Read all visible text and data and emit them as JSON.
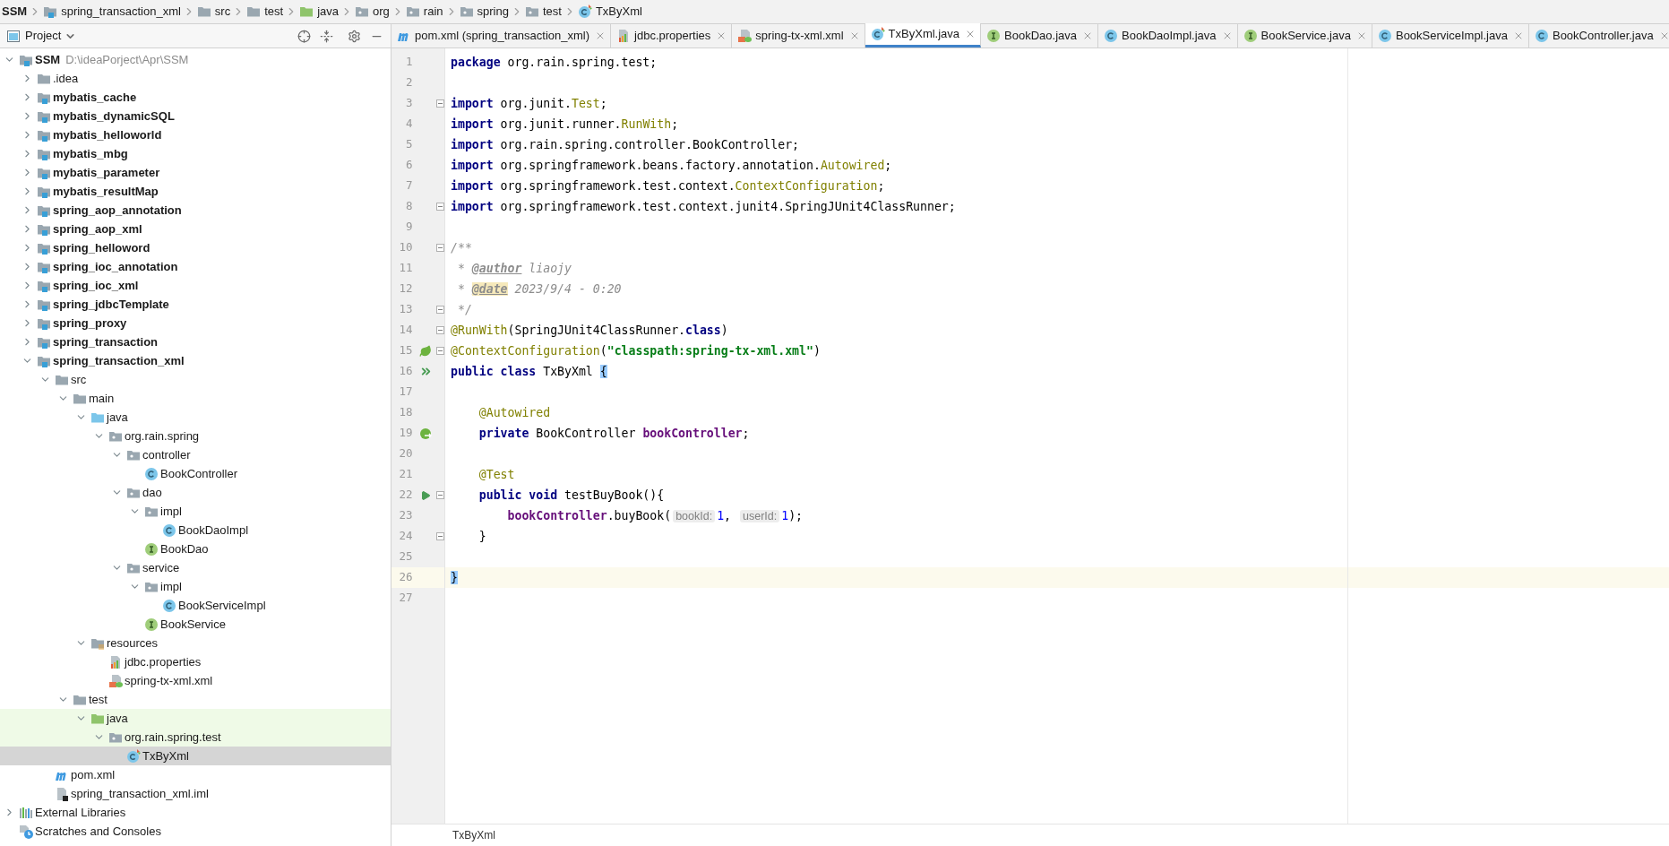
{
  "breadcrumb": [
    {
      "label": "SSM"
    },
    {
      "label": "spring_transaction_xml",
      "kind": "module"
    },
    {
      "label": "src",
      "kind": "folder"
    },
    {
      "label": "test",
      "kind": "folder"
    },
    {
      "label": "java",
      "kind": "test-root"
    },
    {
      "label": "org",
      "kind": "package"
    },
    {
      "label": "rain",
      "kind": "package"
    },
    {
      "label": "spring",
      "kind": "package"
    },
    {
      "label": "test",
      "kind": "package"
    },
    {
      "label": "TxByXml",
      "kind": "test-class"
    }
  ],
  "project_panel": {
    "title": "Project",
    "tree": [
      {
        "label": "SSM",
        "path": "D:\\ideaPorject\\Apr\\SSM",
        "kind": "module",
        "expanded": true,
        "selected": false,
        "highlighted": false,
        "children": [
          {
            "label": ".idea",
            "kind": "folder",
            "expanded": false,
            "selected": false,
            "highlighted": false
          },
          {
            "label": "mybatis_cache",
            "kind": "module",
            "expanded": false,
            "selected": false,
            "highlighted": false
          },
          {
            "label": "mybatis_dynamicSQL",
            "kind": "module",
            "expanded": false,
            "selected": false,
            "highlighted": false
          },
          {
            "label": "mybatis_helloworld",
            "kind": "module",
            "expanded": false,
            "selected": false,
            "highlighted": false
          },
          {
            "label": "mybatis_mbg",
            "kind": "module",
            "expanded": false,
            "selected": false,
            "highlighted": false
          },
          {
            "label": "mybatis_parameter",
            "kind": "module",
            "expanded": false,
            "selected": false,
            "highlighted": false
          },
          {
            "label": "mybatis_resultMap",
            "kind": "module",
            "expanded": false,
            "selected": false,
            "highlighted": false
          },
          {
            "label": "spring_aop_annotation",
            "kind": "module",
            "expanded": false,
            "selected": false,
            "highlighted": false
          },
          {
            "label": "spring_aop_xml",
            "kind": "module",
            "expanded": false,
            "selected": false,
            "highlighted": false
          },
          {
            "label": "spring_helloword",
            "kind": "module",
            "expanded": false,
            "selected": false,
            "highlighted": false
          },
          {
            "label": "spring_ioc_annotation",
            "kind": "module",
            "expanded": false,
            "selected": false,
            "highlighted": false
          },
          {
            "label": "spring_ioc_xml",
            "kind": "module",
            "expanded": false,
            "selected": false,
            "highlighted": false
          },
          {
            "label": "spring_jdbcTemplate",
            "kind": "module",
            "expanded": false,
            "selected": false,
            "highlighted": false
          },
          {
            "label": "spring_proxy",
            "kind": "module",
            "expanded": false,
            "selected": false,
            "highlighted": false
          },
          {
            "label": "spring_transaction",
            "kind": "module",
            "expanded": false,
            "selected": false,
            "highlighted": false
          },
          {
            "label": "spring_transaction_xml",
            "kind": "module",
            "expanded": true,
            "selected": false,
            "highlighted": false,
            "children": [
              {
                "label": "src",
                "kind": "folder",
                "expanded": true,
                "selected": false,
                "highlighted": false,
                "children": [
                  {
                    "label": "main",
                    "kind": "folder",
                    "expanded": true,
                    "selected": false,
                    "highlighted": false,
                    "children": [
                      {
                        "label": "java",
                        "kind": "source-root",
                        "expanded": true,
                        "selected": false,
                        "highlighted": false,
                        "children": [
                          {
                            "label": "org.rain.spring",
                            "kind": "package",
                            "expanded": true,
                            "selected": false,
                            "highlighted": false,
                            "children": [
                              {
                                "label": "controller",
                                "kind": "package",
                                "expanded": true,
                                "selected": false,
                                "highlighted": false,
                                "children": [
                                  {
                                    "label": "BookController",
                                    "kind": "class",
                                    "selected": false,
                                    "highlighted": false
                                  }
                                ]
                              },
                              {
                                "label": "dao",
                                "kind": "package",
                                "expanded": true,
                                "selected": false,
                                "highlighted": false,
                                "children": [
                                  {
                                    "label": "impl",
                                    "kind": "package",
                                    "expanded": true,
                                    "selected": false,
                                    "highlighted": false,
                                    "children": [
                                      {
                                        "label": "BookDaoImpl",
                                        "kind": "class",
                                        "selected": false,
                                        "highlighted": false
                                      }
                                    ]
                                  },
                                  {
                                    "label": "BookDao",
                                    "kind": "interface",
                                    "selected": false,
                                    "highlighted": false
                                  }
                                ]
                              },
                              {
                                "label": "service",
                                "kind": "package",
                                "expanded": true,
                                "selected": false,
                                "highlighted": false,
                                "children": [
                                  {
                                    "label": "impl",
                                    "kind": "package",
                                    "expanded": true,
                                    "selected": false,
                                    "highlighted": false,
                                    "children": [
                                      {
                                        "label": "BookServiceImpl",
                                        "kind": "class",
                                        "selected": false,
                                        "highlighted": false
                                      }
                                    ]
                                  },
                                  {
                                    "label": "BookService",
                                    "kind": "interface",
                                    "selected": false,
                                    "highlighted": false
                                  }
                                ]
                              }
                            ]
                          }
                        ]
                      },
                      {
                        "label": "resources",
                        "kind": "resources",
                        "expanded": true,
                        "selected": false,
                        "highlighted": false,
                        "children": [
                          {
                            "label": "jdbc.properties",
                            "kind": "properties",
                            "selected": false,
                            "highlighted": false
                          },
                          {
                            "label": "spring-tx-xml.xml",
                            "kind": "spring-xml",
                            "selected": false,
                            "highlighted": false
                          }
                        ]
                      }
                    ]
                  },
                  {
                    "label": "test",
                    "kind": "folder",
                    "expanded": true,
                    "selected": false,
                    "highlighted": false,
                    "children": [
                      {
                        "label": "java",
                        "kind": "test-root",
                        "expanded": true,
                        "selected": false,
                        "highlighted": true,
                        "children": [
                          {
                            "label": "org.rain.spring.test",
                            "kind": "package",
                            "expanded": true,
                            "selected": false,
                            "highlighted": true,
                            "children": [
                              {
                                "label": "TxByXml",
                                "kind": "test-class",
                                "selected": true,
                                "highlighted": false
                              }
                            ]
                          }
                        ]
                      }
                    ]
                  }
                ]
              },
              {
                "label": "pom.xml",
                "kind": "maven",
                "selected": false,
                "highlighted": false
              },
              {
                "label": "spring_transaction_xml.iml",
                "kind": "iml",
                "selected": false,
                "highlighted": false
              }
            ]
          }
        ]
      },
      {
        "label": "External Libraries",
        "kind": "libraries",
        "expanded": false,
        "selected": false,
        "highlighted": false
      },
      {
        "label": "Scratches and Consoles",
        "kind": "scratches",
        "selected": false,
        "highlighted": false
      }
    ]
  },
  "tabs": [
    {
      "label": "pom.xml (spring_transaction_xml)",
      "kind": "maven",
      "selected": false
    },
    {
      "label": "jdbc.properties",
      "kind": "properties",
      "selected": false
    },
    {
      "label": "spring-tx-xml.xml",
      "kind": "spring-xml",
      "selected": false
    },
    {
      "label": "TxByXml.java",
      "kind": "test-class",
      "selected": true
    },
    {
      "label": "BookDao.java",
      "kind": "interface",
      "selected": false
    },
    {
      "label": "BookDaoImpl.java",
      "kind": "class",
      "selected": false
    },
    {
      "label": "BookService.java",
      "kind": "interface",
      "selected": false
    },
    {
      "label": "BookServiceImpl.java",
      "kind": "class",
      "selected": false
    },
    {
      "label": "BookController.java",
      "kind": "class",
      "selected": false
    }
  ],
  "editor": {
    "lines": [
      {
        "number": "1",
        "fold": false,
        "current": false,
        "tokens": [
          {
            "kind": "keyword",
            "text": "package"
          },
          {
            "kind": "plain",
            "text": " org.rain.spring.test;"
          }
        ]
      },
      {
        "number": "2",
        "fold": false,
        "current": false
      },
      {
        "number": "3",
        "fold": true,
        "current": false,
        "tokens": [
          {
            "kind": "keyword",
            "text": "import"
          },
          {
            "kind": "plain",
            "text": " org.junit."
          },
          {
            "kind": "reference",
            "text": "Test"
          },
          {
            "kind": "plain",
            "text": ";"
          }
        ]
      },
      {
        "number": "4",
        "fold": false,
        "current": false,
        "tokens": [
          {
            "kind": "keyword",
            "text": "import"
          },
          {
            "kind": "plain",
            "text": " org.junit.runner."
          },
          {
            "kind": "reference",
            "text": "RunWith"
          },
          {
            "kind": "plain",
            "text": ";"
          }
        ]
      },
      {
        "number": "5",
        "fold": false,
        "current": false,
        "tokens": [
          {
            "kind": "keyword",
            "text": "import"
          },
          {
            "kind": "plain",
            "text": " org.rain.spring.controller.BookController;"
          }
        ]
      },
      {
        "number": "6",
        "fold": false,
        "current": false,
        "tokens": [
          {
            "kind": "keyword",
            "text": "import"
          },
          {
            "kind": "plain",
            "text": " org.springframework.beans.factory.annotation."
          },
          {
            "kind": "reference",
            "text": "Autowired"
          },
          {
            "kind": "plain",
            "text": ";"
          }
        ]
      },
      {
        "number": "7",
        "fold": false,
        "current": false,
        "tokens": [
          {
            "kind": "keyword",
            "text": "import"
          },
          {
            "kind": "plain",
            "text": " org.springframework.test.context."
          },
          {
            "kind": "reference",
            "text": "ContextConfiguration"
          },
          {
            "kind": "plain",
            "text": ";"
          }
        ]
      },
      {
        "number": "8",
        "fold": true,
        "current": false,
        "tokens": [
          {
            "kind": "keyword",
            "text": "import"
          },
          {
            "kind": "plain",
            "text": " org.springframework.test.context.junit4.SpringJUnit4ClassRunner;"
          }
        ]
      },
      {
        "number": "9",
        "fold": false,
        "current": false
      },
      {
        "number": "10",
        "fold": true,
        "current": false,
        "tokens": [
          {
            "kind": "comment",
            "text": "/**"
          }
        ]
      },
      {
        "number": "11",
        "fold": false,
        "current": false,
        "tokens": [
          {
            "kind": "comment",
            "text": " * "
          },
          {
            "kind": "doctag",
            "text": "@author"
          },
          {
            "kind": "comment",
            "text": " liaojy"
          }
        ]
      },
      {
        "number": "12",
        "fold": false,
        "current": false,
        "tokens": [
          {
            "kind": "comment",
            "text": " * "
          },
          {
            "kind": "doctag-marked",
            "text": "@date"
          },
          {
            "kind": "comment",
            "text": " 2023/9/4 - 0:20"
          }
        ]
      },
      {
        "number": "13",
        "fold": true,
        "current": false,
        "tokens": [
          {
            "kind": "comment",
            "text": " */"
          }
        ]
      },
      {
        "number": "14",
        "fold": true,
        "current": false,
        "tokens": [
          {
            "kind": "annotation",
            "text": "@RunWith"
          },
          {
            "kind": "plain",
            "text": "(SpringJUnit4ClassRunner."
          },
          {
            "kind": "keyword",
            "text": "class"
          },
          {
            "kind": "plain",
            "text": ")"
          }
        ]
      },
      {
        "number": "15",
        "fold": true,
        "current": false,
        "gutter": {
          "kind": "leaf"
        },
        "tokens": [
          {
            "kind": "annotation",
            "text": "@ContextConfiguration"
          },
          {
            "kind": "plain",
            "text": "("
          },
          {
            "kind": "string",
            "text": "\"classpath:spring-tx-xml.xml\""
          },
          {
            "kind": "plain",
            "text": ")"
          }
        ]
      },
      {
        "number": "16",
        "fold": false,
        "current": false,
        "gutter": {
          "kind": "run-all"
        },
        "tokens": [
          {
            "kind": "keyword",
            "text": "public "
          },
          {
            "kind": "keyword",
            "text": "class"
          },
          {
            "kind": "plain",
            "text": " TxByXml "
          },
          {
            "kind": "brace",
            "text": "{"
          }
        ]
      },
      {
        "number": "17",
        "fold": false,
        "current": false
      },
      {
        "number": "18",
        "fold": false,
        "current": false,
        "tokens": [
          {
            "kind": "annotation",
            "text": "    @Autowired"
          }
        ]
      },
      {
        "number": "19",
        "fold": false,
        "current": false,
        "gutter": {
          "kind": "bean"
        },
        "tokens": [
          {
            "kind": "keyword",
            "text": "    private"
          },
          {
            "kind": "plain",
            "text": " BookController "
          },
          {
            "kind": "field",
            "text": "bookController"
          },
          {
            "kind": "plain",
            "text": ";"
          }
        ]
      },
      {
        "number": "20",
        "fold": false,
        "current": false
      },
      {
        "number": "21",
        "fold": false,
        "current": false,
        "tokens": [
          {
            "kind": "annotation",
            "text": "    @Test"
          }
        ]
      },
      {
        "number": "22",
        "fold": true,
        "current": false,
        "gutter": {
          "kind": "run"
        },
        "tokens": [
          {
            "kind": "keyword",
            "text": "    public void"
          },
          {
            "kind": "plain",
            "text": " testBuyBook(){"
          }
        ]
      },
      {
        "number": "23",
        "fold": false,
        "current": false,
        "tokens": [
          {
            "kind": "field",
            "text": "        bookController"
          },
          {
            "kind": "plain",
            "text": ".buyBook("
          },
          {
            "kind": "hint",
            "text": "bookId:"
          },
          {
            "kind": "number",
            "text": "1"
          },
          {
            "kind": "plain",
            "text": ", "
          },
          {
            "kind": "hint",
            "text": "userId:"
          },
          {
            "kind": "number",
            "text": "1"
          },
          {
            "kind": "plain",
            "text": ");"
          }
        ]
      },
      {
        "number": "24",
        "fold": true,
        "current": false,
        "tokens": [
          {
            "kind": "plain",
            "text": "    }"
          }
        ]
      },
      {
        "number": "25",
        "fold": false,
        "current": false
      },
      {
        "number": "26",
        "fold": false,
        "current": true,
        "tokens": [
          {
            "kind": "brace",
            "text": "}"
          }
        ]
      },
      {
        "number": "27",
        "fold": false,
        "current": false
      }
    ]
  },
  "editor_breadcrumb": "TxByXml"
}
